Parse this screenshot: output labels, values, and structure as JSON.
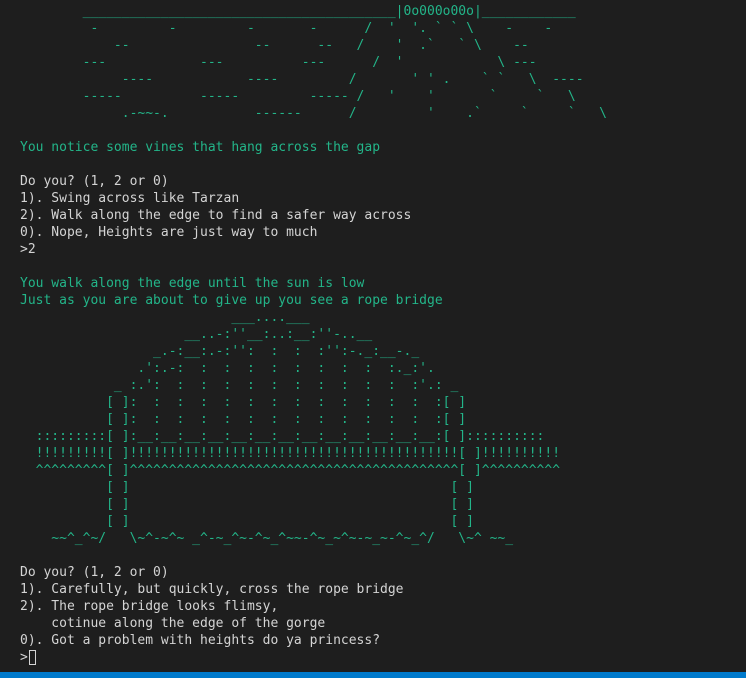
{
  "art_cliff": [
    "        ________________________________________|0o000o00o|____________",
    "         -         -         -       -      /  '  '. ` ` \\    -    -",
    "            --                --      --   /    '  .`   ` \\    --",
    "        ---            ---          ---      /  '            \\ ---",
    "             ----            ----         /       ' ' .    ` `   \\  ----",
    "        -----          -----         ----- /   '    '       `     `   \\",
    "             .-~~-.           ------      /         '    .`     `     `   \\"
  ],
  "story1": "You notice some vines that hang across the gap",
  "prompt1": {
    "question": "Do you? (1, 2 or 0)",
    "options": [
      "1). Swing across like Tarzan",
      "2). Walk along the edge to find a safer way across",
      "0). Nope, Heights are just way to much"
    ],
    "input": ">2"
  },
  "story2": [
    "You walk along the edge until the sun is low",
    "Just as you are about to give up you see a rope bridge"
  ],
  "art_bridge": [
    "                           ___....___",
    "                     __..-:''__:..:__:''-..__",
    "                 _.-:__:.-:'':  :  :  :'':-._:__-._",
    "               .':.-:  :  :  :  :  :  :  :  :  :._:'.",
    "            _ :.':  :  :  :  :  :  :  :  :  :  :  :'.: _",
    "           [ ]:  :  :  :  :  :  :  :  :  :  :  :  :  :[ ]",
    "           [ ]:  :  :  :  :  :  :  :  :  :  :  :  :  :[ ]",
    "  :::::::::[ ]:__:__:__:__:__:__:__:__:__:__:__:__:__:[ ]::::::::::",
    "  !!!!!!!!![ ]!!!!!!!!!!!!!!!!!!!!!!!!!!!!!!!!!!!!!!!!!![ ]!!!!!!!!!!",
    "  ^^^^^^^^^[ ]^^^^^^^^^^^^^^^^^^^^^^^^^^^^^^^^^^^^^^^^^^[ ]^^^^^^^^^^",
    "           [ ]                                         [ ]",
    "           [ ]                                         [ ]",
    "           [ ]                                         [ ]",
    "    ~~^_^~/   \\~^-~^~ _^-~_^~-^~_^~~-^~_~^~-~_~-^~_^/   \\~^ ~~_"
  ],
  "prompt2": {
    "question": "Do you? (1, 2 or 0)",
    "options": [
      "1). Carefully, but quickly, cross the rope bridge",
      "2). The rope bridge looks flimsy,",
      "    cotinue along the edge of the gorge",
      "0). Got a problem with heights do ya princess?"
    ],
    "input": ">"
  },
  "colors": {
    "background": "#1e1e1e",
    "green_text": "#23b589",
    "white_text": "#d4d4d4",
    "status_bar": "#007acc"
  }
}
